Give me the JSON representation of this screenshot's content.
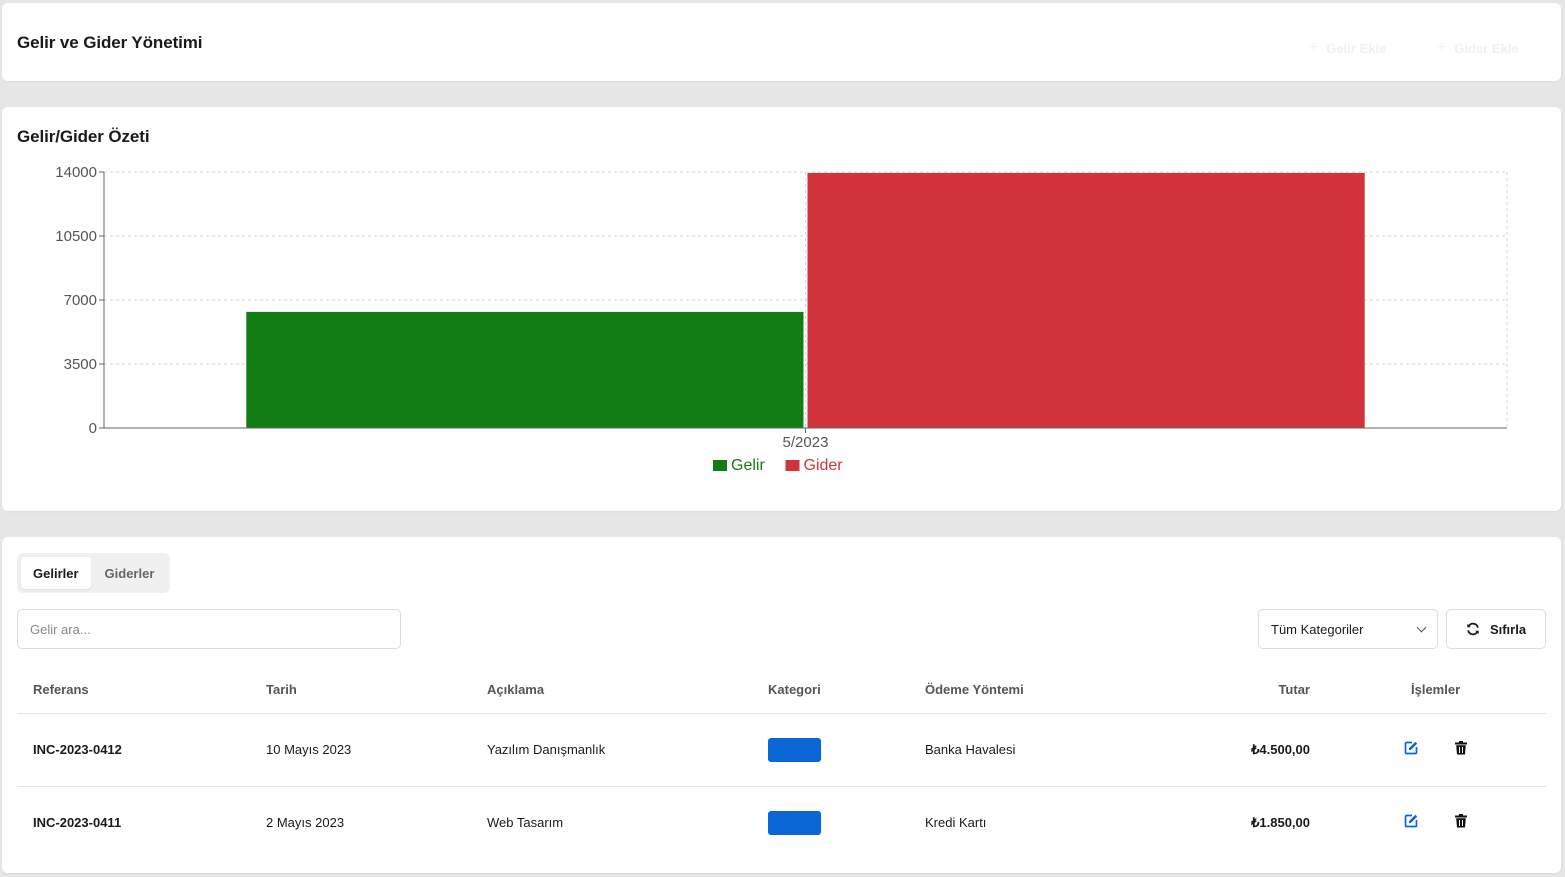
{
  "header": {
    "title": "Gelir ve Gider Yönetimi",
    "add_income_label": "Gelir Ekle",
    "add_expense_label": "Gider Ekle",
    "plus_glyph": "+"
  },
  "summary": {
    "title": "Gelir/Gider Özeti"
  },
  "chart_data": {
    "type": "bar",
    "categories": [
      "5/2023"
    ],
    "series": [
      {
        "name": "Gelir",
        "values": [
          6350
        ],
        "color": "#127d12"
      },
      {
        "name": "Gider",
        "values": [
          13950
        ],
        "color": "#d0343a"
      }
    ],
    "ylim": [
      0,
      14000
    ],
    "yticks": [
      0,
      3500,
      7000,
      10500,
      14000
    ],
    "title": "",
    "xlabel": "",
    "ylabel": "",
    "grid": true,
    "legend": "bottom-center"
  },
  "tabs": [
    {
      "label": "Gelirler",
      "active": true
    },
    {
      "label": "Giderler",
      "active": false
    }
  ],
  "filters": {
    "search_placeholder": "Gelir ara...",
    "category_value": "Tüm Kategoriler",
    "reset_label": "Sıfırla"
  },
  "table": {
    "columns": [
      "Referans",
      "Tarih",
      "Açıklama",
      "Kategori",
      "Ödeme Yöntemi",
      "Tutar",
      "İşlemler"
    ],
    "rows": [
      {
        "ref": "INC-2023-0412",
        "date": "10 Mayıs 2023",
        "desc": "Yazılım Danışmanlık",
        "category_color": "#0a66d4",
        "payment": "Banka Havalesi",
        "amount": "₺4.500,00"
      },
      {
        "ref": "INC-2023-0411",
        "date": "2 Mayıs 2023",
        "desc": "Web Tasarım",
        "category_color": "#0a66d4",
        "payment": "Kredi Kartı",
        "amount": "₺1.850,00"
      }
    ]
  },
  "icons": {
    "edit": "edit-icon",
    "delete": "trash-icon",
    "reset": "refresh-icon",
    "select": "chevron-down-icon"
  }
}
